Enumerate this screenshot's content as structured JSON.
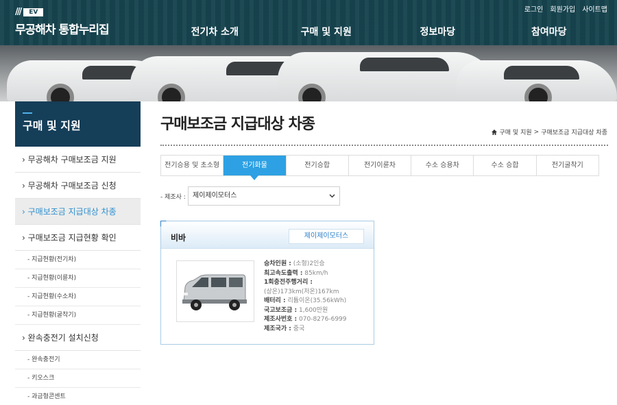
{
  "header": {
    "logo_ev": "EV",
    "logo_stripes": "///",
    "logo_text": "무공해차 통합누리집",
    "util": [
      "로그인",
      "회원가입",
      "사이트맵"
    ],
    "gnb": [
      "전기차 소개",
      "구매 및 지원",
      "정보마당",
      "참여마당"
    ]
  },
  "sidebar": {
    "title": "구매 및 지원",
    "items": [
      {
        "label": "› 무공해차 구매보조금 지원",
        "type": "main"
      },
      {
        "label": "› 무공해차 구매보조금 신청",
        "type": "main"
      },
      {
        "label": "› 구매보조금 지급대상 차종",
        "type": "main",
        "active": true
      },
      {
        "label": "› 구매보조금 지급현황 확인",
        "type": "main"
      },
      {
        "label": "- 지급현황(전기차)",
        "type": "sub"
      },
      {
        "label": "- 지급현황(이륜차)",
        "type": "sub"
      },
      {
        "label": "- 지급현황(수소차)",
        "type": "sub"
      },
      {
        "label": "- 지급현황(굴착기)",
        "type": "sub"
      },
      {
        "label": "› 완속충전기 설치신청",
        "type": "main"
      },
      {
        "label": "- 완속충전기",
        "type": "sub"
      },
      {
        "label": "- 키오스크",
        "type": "sub"
      },
      {
        "label": "- 과금형콘센트",
        "type": "sub"
      }
    ]
  },
  "main": {
    "title": "구매보조금 지급대상 차종",
    "breadcrumb": [
      "구매 및 지원",
      "구매보조금 지급대상 차종"
    ],
    "breadcrumb_sep": ">",
    "tabs": [
      "전기승용 및 초소형",
      "전기화물",
      "전기승합",
      "전기이륜차",
      "수소 승용차",
      "수소 승합",
      "전기굴착기"
    ],
    "active_tab": 1,
    "maker_label": "- 제조사 :",
    "maker_value": "제이제이모터스",
    "card": {
      "model": "비바",
      "maker": "제이제이모터스",
      "specs": [
        {
          "k": "승차인원 :",
          "v": "(소형)2인승"
        },
        {
          "k": "최고속도출력 :",
          "v": "85km/h"
        },
        {
          "k": "1회충전주행거리 :",
          "v": ""
        },
        {
          "k": "",
          "v": "(상온)173km(저온)167km"
        },
        {
          "k": "배터리 :",
          "v": "리튬이온(35.56kWh)"
        },
        {
          "k": "국고보조금 :",
          "v": "1,600만원"
        },
        {
          "k": "제조사번호 :",
          "v": "070-8276-6999"
        },
        {
          "k": "제조국가 :",
          "v": "중국"
        }
      ]
    }
  },
  "colors": {
    "header": "#17444f",
    "sidebar_title": "#153e59",
    "accent": "#2da1e3",
    "active_link": "#2e8fd0"
  }
}
